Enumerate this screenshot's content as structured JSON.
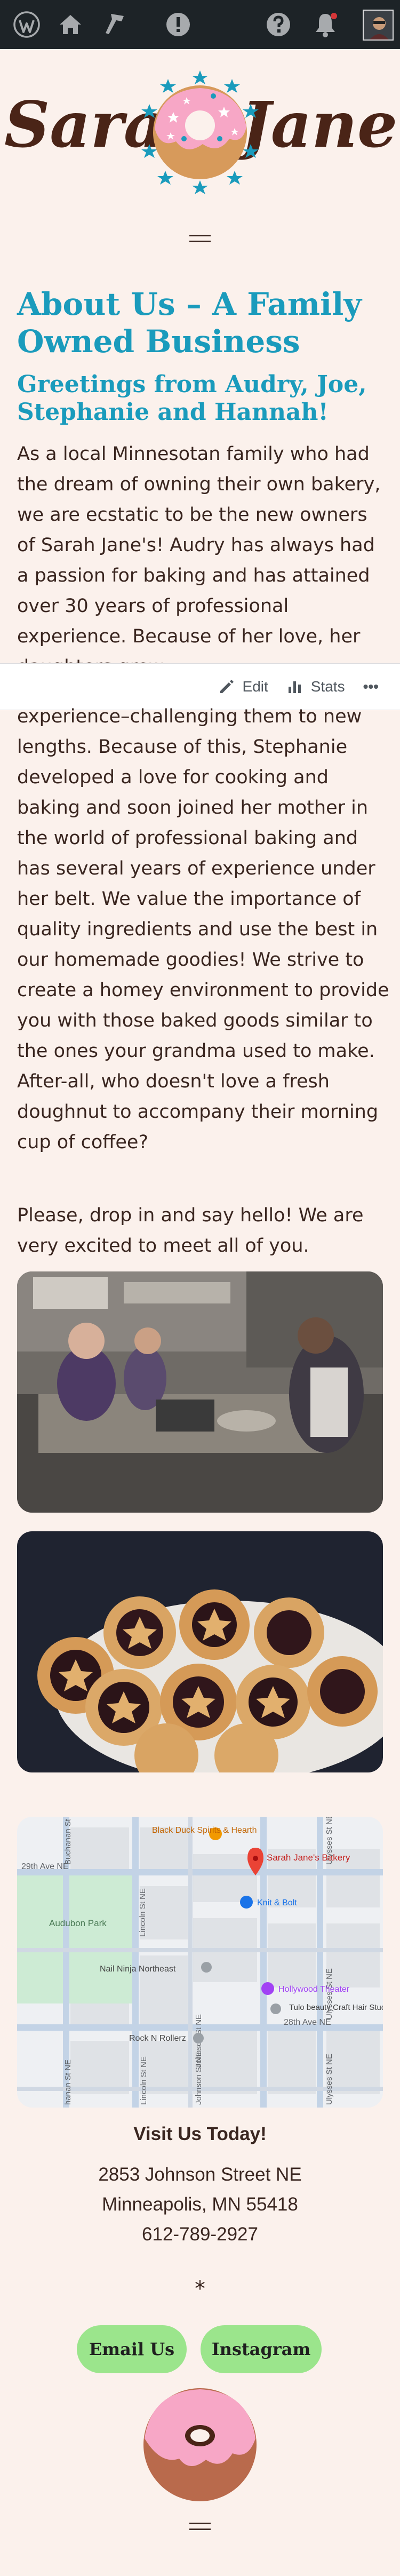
{
  "admin_bar": {
    "icons": [
      "wordpress-icon",
      "home-icon",
      "customize-icon",
      "alert-icon",
      "help-icon",
      "notifications-icon",
      "avatar"
    ]
  },
  "site": {
    "logo_text_left": "Sarah",
    "logo_text_right": "Jane's"
  },
  "page": {
    "title": "About Us – A Family Owned Business",
    "subtitle": "Greetings from Audry, Joe, Stephanie and Hannah!",
    "paragraph1_visible": "As a local Minnesotan family who had the dream of owning their own bakery, we are ecstatic to be the new owners of Sarah Jane's! Audry has always had a passion for baking and has attained over 30 years of professional experience. Because of her love, her daughters grew",
    "paragraph1_continued": "experience–challenging them to new lengths. Because of this, Stephanie developed a love for cooking and baking and soon joined her mother in the world of professional baking and has several years of experience under her belt. We value the importance of quality ingredients and use the best in our homemade goodies! We strive to create a homey environment to provide you with those baked goods similar to the ones your grandma used to make. After-all, who doesn't love a fresh doughnut to accompany their morning cup of coffee?",
    "paragraph2": "Please, drop in and say hello! We are very excited to meet all of you."
  },
  "edit_bar": {
    "edit_label": "Edit",
    "stats_label": "Stats",
    "more_label": "•••"
  },
  "map": {
    "labels": {
      "black_duck": "Black Duck Spirits & Hearth",
      "sarah_janes": "Sarah Jane's Bakery",
      "knit_bolt": "Knit & Bolt",
      "audubon": "Audubon Park",
      "nail_ninja": "Nail Ninja Northeast",
      "hollywood": "Hollywood Theater",
      "tulo": "Tulo beauty Craft Hair Studio",
      "rock_n_rollerz": "Rock N Rollerz",
      "st29": "29th Ave NE",
      "st28": "28th Ave NE",
      "lincoln": "Lincoln St NE",
      "johnson": "Johnson St NE",
      "ulysses": "Ulysses St NE",
      "buchanan": "Buchanan St NE",
      "lincoln_bottom": "Lincoln St NE",
      "johnson_bottom": "Johnson St NE",
      "ulysses_bottom": "Ulysses St NE",
      "buchanan_bottom": "hanan St NE",
      "ulysses_right": "Ulysses St NE"
    }
  },
  "visit": {
    "title": "Visit Us Today!",
    "address_line1": "2853 Johnson Street NE",
    "address_line2": "Minneapolis, MN 55418",
    "phone": "612-789-2927"
  },
  "separator": "*",
  "buttons": {
    "email": "Email Us",
    "instagram": "Instagram"
  },
  "colors": {
    "accent": "#1a9bbc",
    "brand_brown": "#4a2417",
    "donut_pink": "#f7a7c6",
    "button_green": "#9be58c",
    "background": "#fbf1ec",
    "admin_bar": "#1d2327"
  }
}
